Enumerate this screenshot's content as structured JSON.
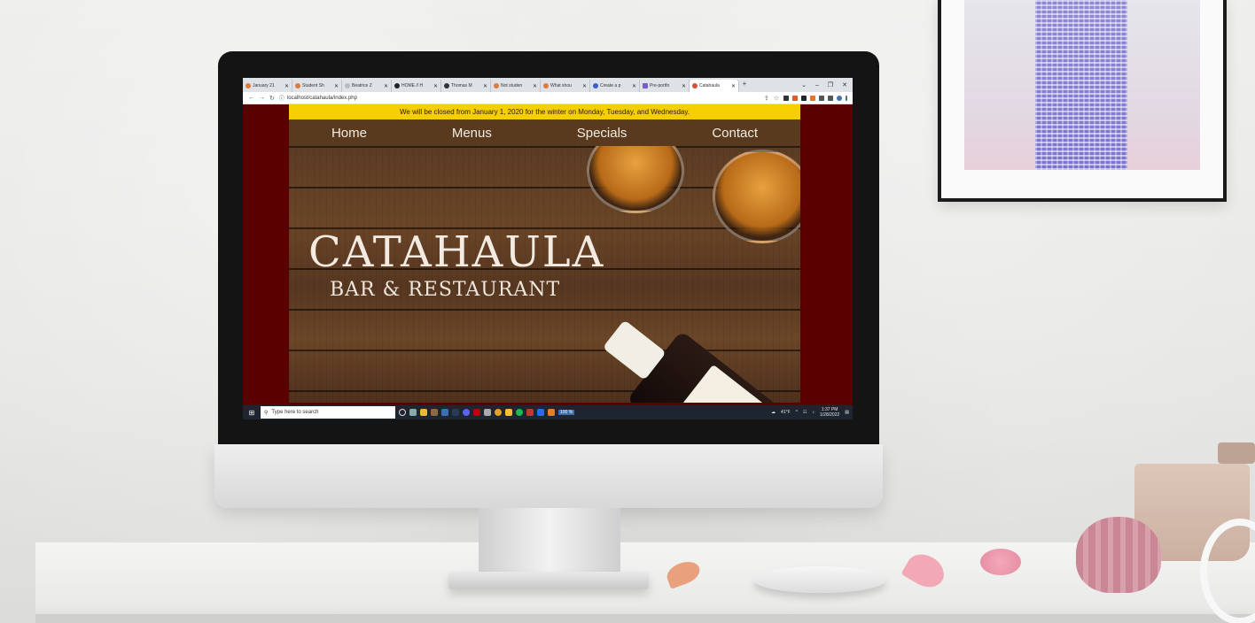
{
  "browser": {
    "tabs": [
      {
        "label": "January 21",
        "active": false
      },
      {
        "label": "Student Sh",
        "active": false
      },
      {
        "label": "Beatrice Z",
        "active": false
      },
      {
        "label": "HOME // H",
        "active": false
      },
      {
        "label": "Thomas M",
        "active": false
      },
      {
        "label": "Not studen",
        "active": false
      },
      {
        "label": "What shou",
        "active": false
      },
      {
        "label": "Create a p",
        "active": false
      },
      {
        "label": "Pre-portfo",
        "active": false
      },
      {
        "label": "Catahaula",
        "active": true
      }
    ],
    "new_tab": "+",
    "url": "localhost/catahaula/index.php"
  },
  "site": {
    "banner": "We will be closed from January 1, 2020 for the winter on Monday, Tuesday, and Wednesday.",
    "nav": [
      "Home",
      "Menus",
      "Specials",
      "Contact"
    ],
    "hero_title": "CATAHAULA",
    "hero_subtitle": "BAR & RESTAURANT",
    "colors": {
      "banner": "#f6cf00",
      "nav_bg": "#5a3a1e",
      "page_bg": "#5a0000"
    }
  },
  "taskbar": {
    "search_placeholder": "Type here to search",
    "zoom": "100 %",
    "weather": "41°F",
    "time": "1:37 PM",
    "date": "1/28/2022"
  }
}
